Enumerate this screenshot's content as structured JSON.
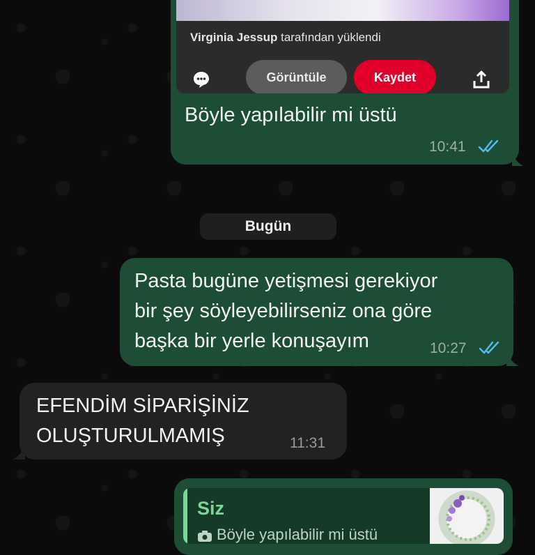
{
  "pinterest": {
    "uploader_name": "Virginia Jessup",
    "uploader_suffix": "tarafından yüklendi",
    "view_label": "Görüntüle",
    "save_label": "Kaydet"
  },
  "messages": [
    {
      "text": "Böyle yapılabilir mi üstü",
      "time": "10:41",
      "direction": "outgoing",
      "status": "read"
    },
    {
      "lines": [
        "Pasta bugüne yetişmesi gerekiyor",
        "bir şey söyleyebilirseniz ona göre",
        "başka bir yerle konuşayım"
      ],
      "time": "10:27",
      "direction": "outgoing",
      "status": "read"
    },
    {
      "lines": [
        "EFENDİM SİPARİŞİNİZ",
        "OLUŞTURULMAMIŞ"
      ],
      "time": "11:31",
      "direction": "incoming"
    }
  ],
  "date_separator": "Bugün",
  "reply_quote": {
    "name": "Siz",
    "text": "Böyle yapılabilir mi üstü"
  },
  "colors": {
    "outgoing_bubble": "#1e4d36",
    "incoming_bubble": "#222223",
    "read_ticks": "#53bdeb",
    "pinterest_red": "#e0002a"
  },
  "icons": [
    "comment-icon",
    "share-icon",
    "double-check-icon",
    "camera-icon"
  ]
}
